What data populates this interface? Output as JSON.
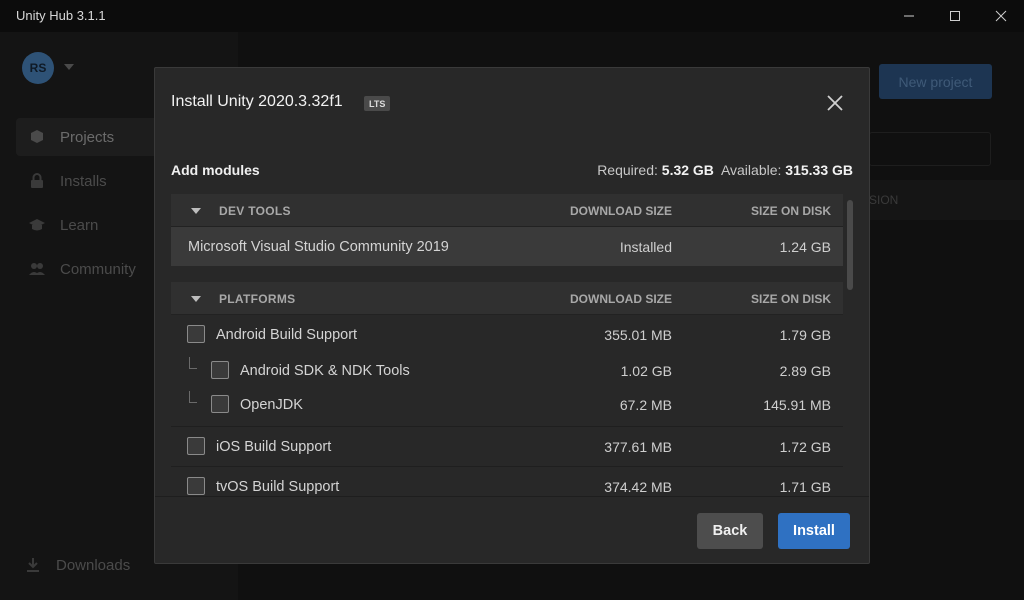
{
  "window": {
    "title": "Unity Hub 3.1.1"
  },
  "sidebar": {
    "avatar_initials": "RS",
    "items": [
      {
        "label": "Projects",
        "icon": "cube-icon"
      },
      {
        "label": "Installs",
        "icon": "lock-icon"
      },
      {
        "label": "Learn",
        "icon": "graduation-cap-icon"
      },
      {
        "label": "Community",
        "icon": "people-icon"
      }
    ],
    "downloads_label": "Downloads"
  },
  "main": {
    "new_project_label": "New project",
    "col_version_partial": "SION"
  },
  "modal": {
    "title": "Install Unity 2020.3.32f1",
    "badge": "LTS",
    "add_modules_label": "Add modules",
    "required_label": "Required:",
    "required_value": "5.32 GB",
    "available_label": "Available:",
    "available_value": "315.33 GB",
    "groups": [
      {
        "name": "DEV TOOLS",
        "col_download": "DOWNLOAD SIZE",
        "col_size": "SIZE ON DISK",
        "rows": [
          {
            "name": "Microsoft Visual Studio Community 2019",
            "download": "Installed",
            "size": "1.24 GB"
          }
        ]
      },
      {
        "name": "PLATFORMS",
        "col_download": "DOWNLOAD SIZE",
        "col_size": "SIZE ON DISK",
        "rows": [
          {
            "name": "Android Build Support",
            "download": "355.01 MB",
            "size": "1.79 GB",
            "checked": false
          },
          {
            "name": "Android SDK & NDK Tools",
            "download": "1.02 GB",
            "size": "2.89 GB",
            "checked": false,
            "child": true
          },
          {
            "name": "OpenJDK",
            "download": "67.2 MB",
            "size": "145.91 MB",
            "checked": false,
            "child": true
          },
          {
            "name": "iOS Build Support",
            "download": "377.61 MB",
            "size": "1.72 GB",
            "checked": false
          },
          {
            "name": "tvOS Build Support",
            "download": "374.42 MB",
            "size": "1.71 GB",
            "checked": false
          }
        ]
      }
    ],
    "back_label": "Back",
    "install_label": "Install"
  },
  "colors": {
    "accent": "#2f71c2",
    "modal_bg": "#282828",
    "app_bg": "#0b0b0b"
  }
}
